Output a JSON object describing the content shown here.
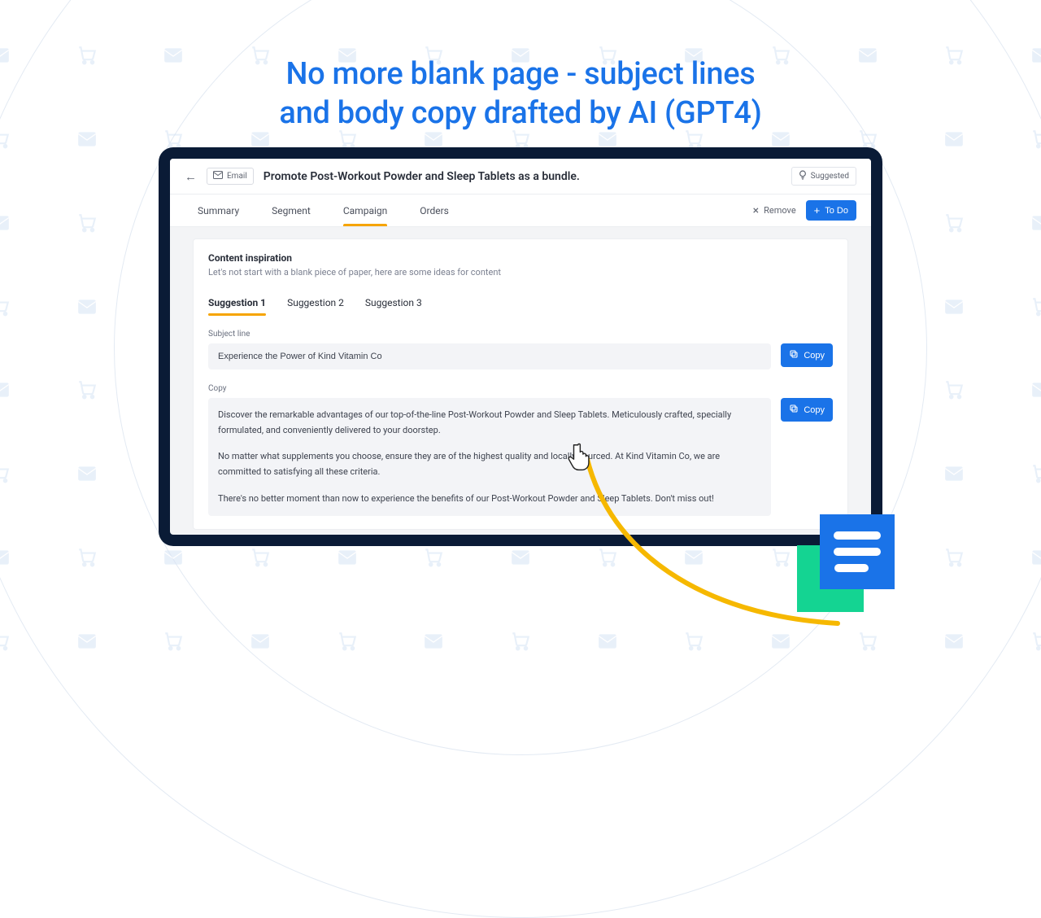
{
  "headline": {
    "line1": "No more blank page - subject lines",
    "line2": "and body copy drafted by AI (GPT4)"
  },
  "topbar": {
    "email_chip": "Email",
    "title": "Promote Post-Workout Powder and Sleep Tablets as a bundle.",
    "suggested": "Suggested"
  },
  "tabs": {
    "summary": "Summary",
    "segment": "Segment",
    "campaign": "Campaign",
    "orders": "Orders",
    "remove": "Remove",
    "todo": "To Do"
  },
  "inspiration": {
    "title": "Content inspiration",
    "sub": "Let's not start with a blank piece of paper, here are some ideas for content",
    "sug1": "Suggestion 1",
    "sug2": "Suggestion 2",
    "sug3": "Suggestion 3"
  },
  "fields": {
    "subject_label": "Subject line",
    "subject_value": "Experience the Power of Kind Vitamin Co",
    "copy_label": "Copy",
    "copy_btn": "Copy",
    "body": {
      "p1": "Discover the remarkable advantages of our top-of-the-line Post-Workout Powder and Sleep Tablets. Meticulously crafted, specially formulated, and conveniently delivered to your doorstep.",
      "p2": "No matter what supplements you choose, ensure they are of the highest quality and locally sourced. At Kind Vitamin Co, we are committed to satisfying all these criteria.",
      "p3": "There's no better moment than now to experience the benefits of our Post-Workout Powder and Sleep Tablets. Don't miss out!"
    }
  }
}
